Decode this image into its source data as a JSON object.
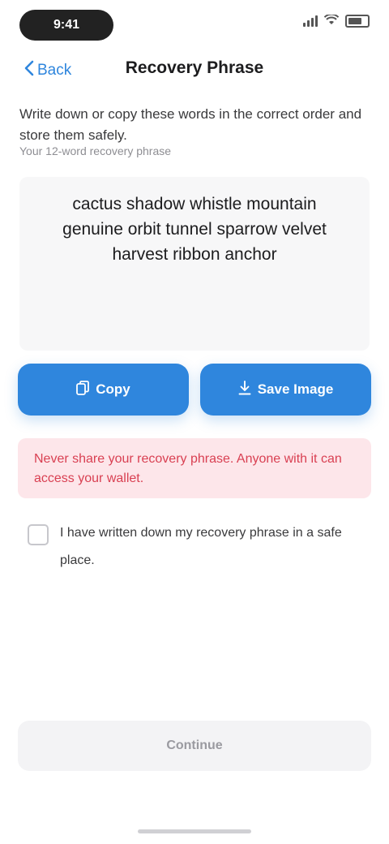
{
  "status_bar": {
    "time": "9:41"
  },
  "nav": {
    "back_label": "Back",
    "title": "Recovery Phrase"
  },
  "instruction": "Write down or copy these words in the correct order and store them safely.",
  "step_label": "Your 12-word recovery phrase",
  "phrase": "cactus shadow whistle mountain genuine orbit tunnel sparrow velvet harvest ribbon anchor",
  "buttons": {
    "copy_label": "Copy",
    "save_label": "Save Image"
  },
  "warning": "Never share your recovery phrase. Anyone with it can access your wallet.",
  "confirm": "I have written down my recovery phrase in a safe place.",
  "continue_label": "Continue",
  "icons": {
    "back": "chevron-left-icon",
    "copy": "copy-icon",
    "save": "download-icon"
  },
  "colors": {
    "accent": "#2f86dd",
    "warning_bg": "#fde6ea",
    "warning_text": "#d94052"
  }
}
